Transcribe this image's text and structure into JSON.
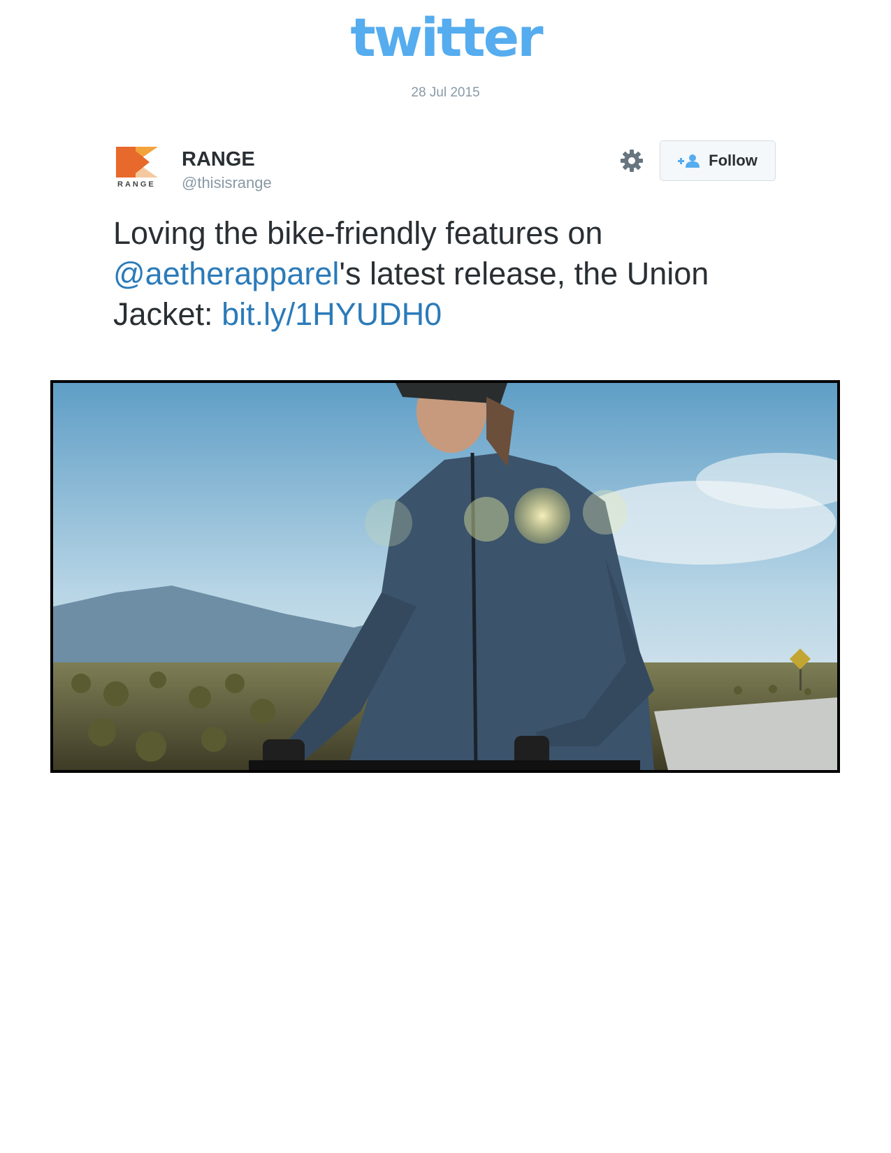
{
  "brand": {
    "wordmark": "twitter",
    "color": "#55acee"
  },
  "tweet": {
    "date": "28 Jul 2015",
    "author": {
      "avatar_caption": "RANGE",
      "display_name": "RANGE",
      "handle": "@thisisrange"
    },
    "follow_label": "Follow",
    "text": {
      "line1": "Loving the bike-friendly features on",
      "mention": "@aetherapparel",
      "line2_rest": "'s latest release, the Union",
      "line3_start": "Jacket: ",
      "link": "bit.ly/1HYUDH0"
    },
    "icons": {
      "settings": "gear-icon",
      "follow": "add-user-icon",
      "logo": "range-logo"
    },
    "colors": {
      "link": "#2b7bb9",
      "text": "#292f33",
      "meta": "#8899a6",
      "logo_orange": "#e8692c",
      "logo_amber": "#f3a33b"
    }
  }
}
